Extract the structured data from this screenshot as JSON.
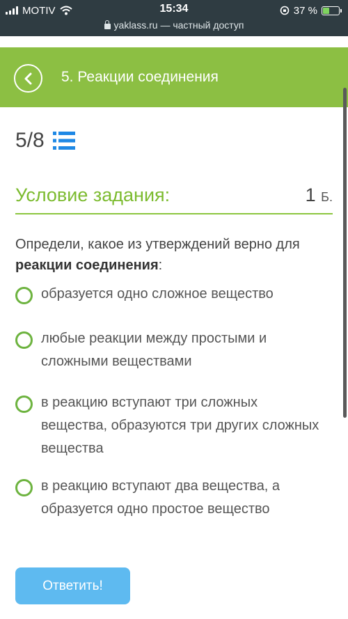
{
  "status_bar": {
    "carrier": "MOTIV",
    "time": "15:34",
    "battery": "37 %",
    "url": "yaklass.ru",
    "url_suffix": " — частный доступ"
  },
  "header": {
    "title": "5. Реакции соединения"
  },
  "progress": {
    "counter": "5/8"
  },
  "task": {
    "title": "Условие задания:",
    "points_value": "1",
    "points_unit": "Б.",
    "question_prefix": "Определи, какое из утверждений верно для ",
    "question_bold": "реакции соединения",
    "question_suffix": ":"
  },
  "options": [
    {
      "text": "образуется одно сложное вещество"
    },
    {
      "text": "любые реакции между простыми и сложными веществами"
    },
    {
      "text": "в реакцию вступают три сложных вещества, образуются три других сложных вещества"
    },
    {
      "text": "в реакцию вступают два вещества, а образуется одно простое вещество"
    }
  ],
  "submit": {
    "label": "Ответить!"
  },
  "colors": {
    "header_green": "#8cbf43",
    "accent_green": "#7cbb2f",
    "button_blue": "#5ebaf0",
    "status_bar": "#2f3c42"
  }
}
